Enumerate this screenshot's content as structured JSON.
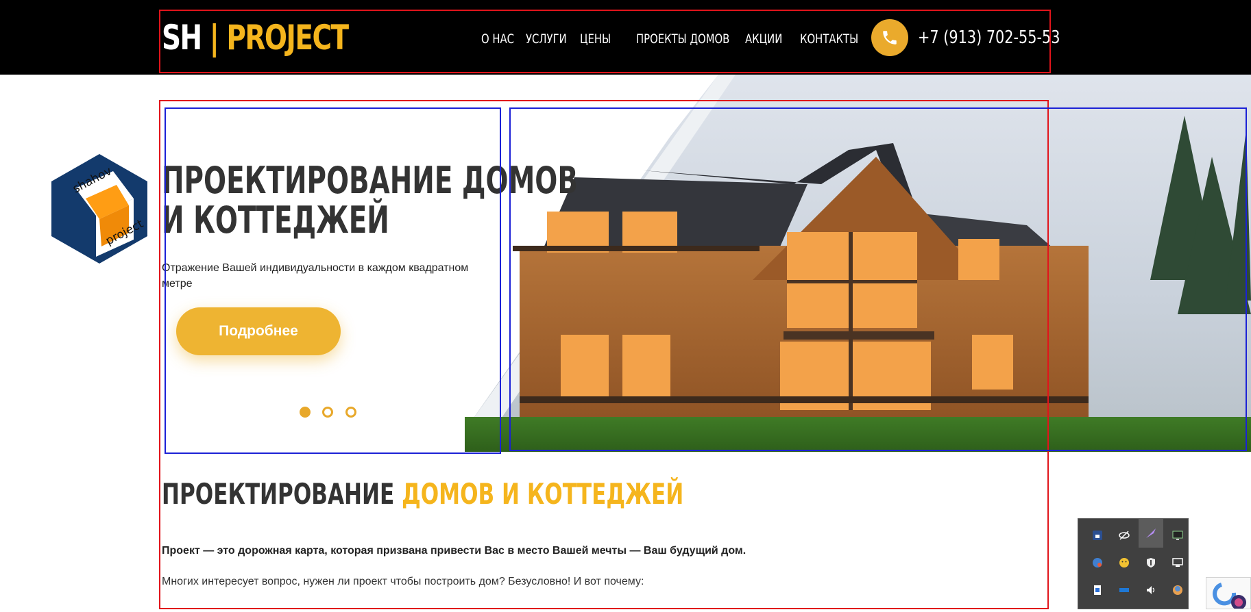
{
  "header": {
    "logo_left": "SH",
    "logo_sep": " | ",
    "logo_right": "PROJECT",
    "nav": [
      {
        "label": "О НАС"
      },
      {
        "label": "УСЛУГИ"
      },
      {
        "label": "ЦЕНЫ"
      },
      {
        "label": "ПРОЕКТЫ ДОМОВ"
      },
      {
        "label": "АКЦИИ"
      },
      {
        "label": "КОНТАКТЫ"
      }
    ],
    "phone_icon": "phone-icon",
    "phone": "+7 (913) 702-55-53"
  },
  "side_badge": {
    "text_top": "shahov",
    "text_bottom": "project"
  },
  "hero": {
    "title_line1": "ПРОЕКТИРОВАНИЕ ДОМОВ",
    "title_line2": "И КОТТЕДЖЕЙ",
    "subtitle": "Отражение Вашей индивидуальности в каждом квадратном метре",
    "button_label": "Подробнее",
    "slides": 3,
    "active_slide": 1
  },
  "section": {
    "title_part1": "ПРОЕКТИРОВАНИЕ ",
    "title_part2": "ДОМОВ И КОТТЕДЖЕЙ",
    "paragraph1": "Проект — это дорожная карта, которая призвана привести Вас в место Вашей мечты — Ваш будущий дом.",
    "paragraph2": "Многих интересует вопрос, нужен ли проект чтобы построить дом? Безусловно! И вот почему:"
  },
  "colors": {
    "accent": "#f5b51d",
    "button": "#eeb432",
    "header_bg": "#000000",
    "annotation_red": "#e1141b",
    "annotation_blue": "#1b21d6"
  },
  "tray": {
    "icons": [
      "lock-icon",
      "eye-slash-icon",
      "feather-icon",
      "monitor-icon",
      "globe-icon",
      "smiley-icon",
      "shield-icon",
      "display-icon",
      "document-icon",
      "battery-icon",
      "volume-icon",
      "sphere-icon"
    ]
  }
}
